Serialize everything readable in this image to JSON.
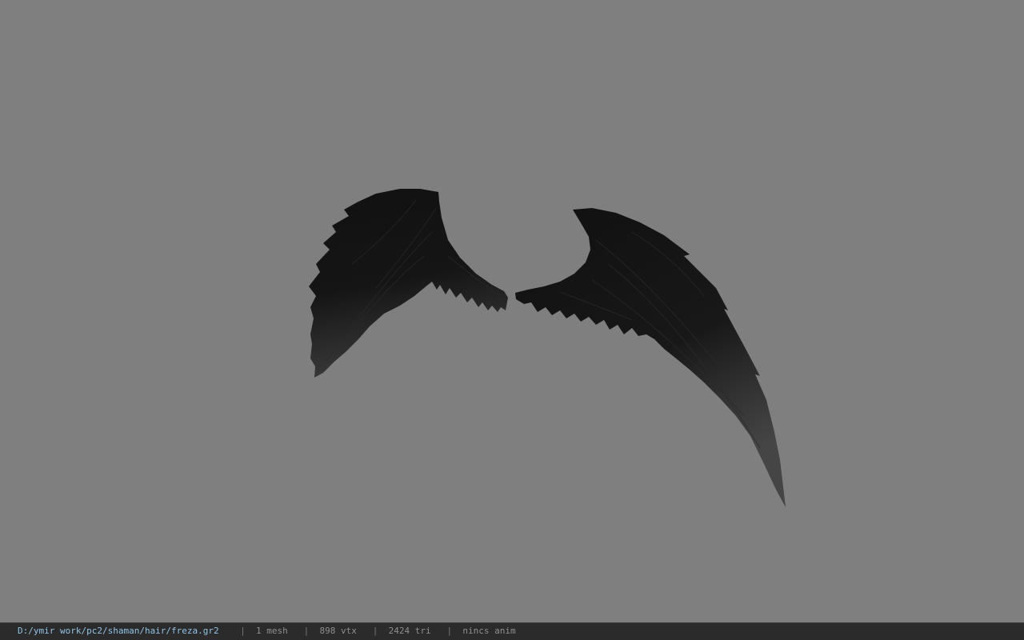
{
  "viewport": {
    "background_color": "#7f7f7f",
    "model_name": "wings"
  },
  "statusbar": {
    "file_path": "D:/ymir work/pc2/shaman/hair/freza.gr2",
    "separator": "|",
    "mesh_count": "1 mesh",
    "vertex_count": "898 vtx",
    "triangle_count": "2424 tri",
    "anim_status": "nincs anim",
    "path_color": "#8fc4e6",
    "background_color": "#2b2b2b"
  }
}
